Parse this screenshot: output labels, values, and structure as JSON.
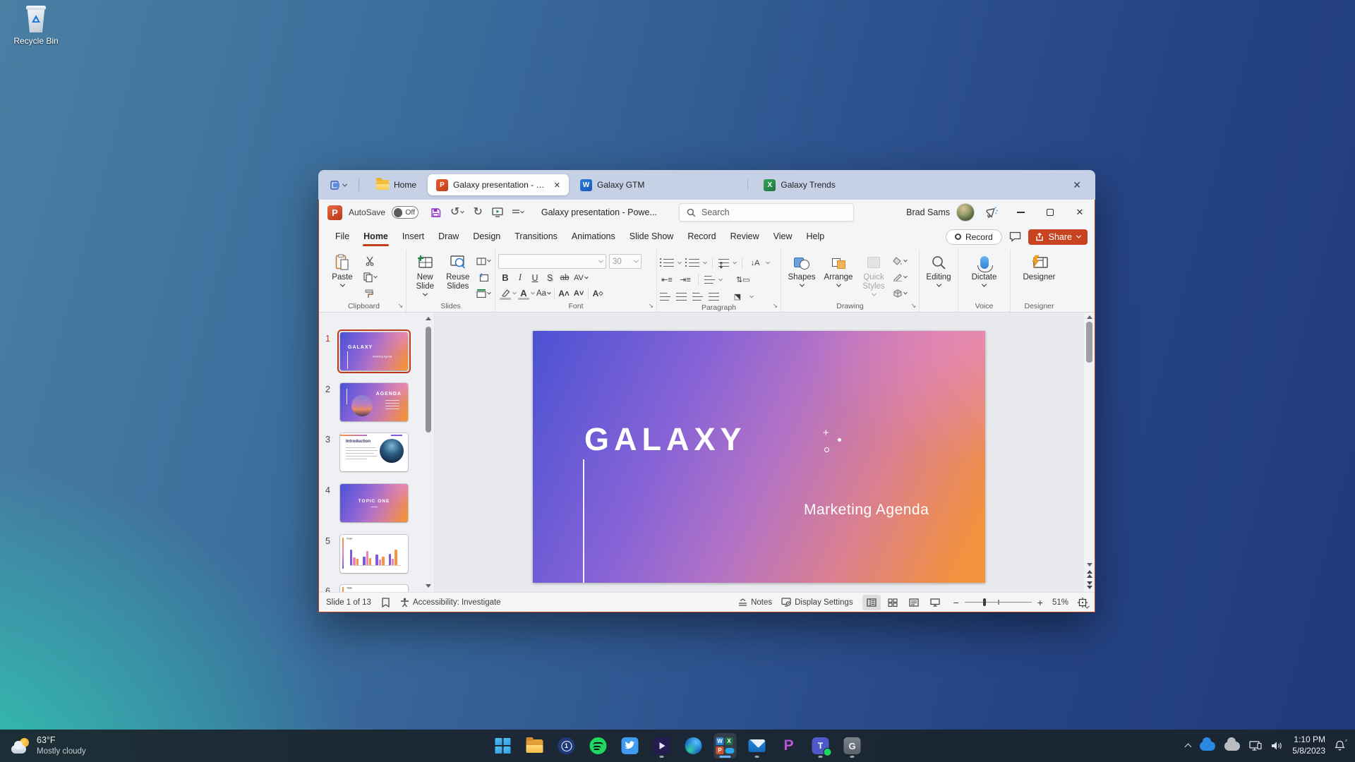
{
  "desktop": {
    "recycle_bin_label": "Recycle Bin"
  },
  "tabstrip": {
    "tabs": [
      {
        "label": "Home"
      },
      {
        "label": "Galaxy presentation - Pow...",
        "close": "✕"
      },
      {
        "label": "Galaxy GTM"
      },
      {
        "label": "Galaxy Trends"
      }
    ],
    "close": "✕"
  },
  "titlebar": {
    "autosave_label": "AutoSave",
    "autosave_state": "Off",
    "document_title": "Galaxy presentation  -  Powe...",
    "search_placeholder": "Search",
    "user_name": "Brad Sams",
    "minimize": "",
    "close": "✕"
  },
  "ribbon": {
    "tabs": [
      "File",
      "Home",
      "Insert",
      "Draw",
      "Design",
      "Transitions",
      "Animations",
      "Slide Show",
      "Record",
      "Review",
      "View",
      "Help"
    ],
    "record_button": "Record",
    "share_button": "Share",
    "clipboard": {
      "paste": "Paste",
      "label": "Clipboard"
    },
    "slides": {
      "new_slide": "New Slide",
      "reuse_slides": "Reuse Slides",
      "label": "Slides"
    },
    "font": {
      "size_value": "30",
      "label": "Font",
      "bold": "B",
      "italic": "I",
      "underline": "U",
      "shadow": "S"
    },
    "paragraph": {
      "label": "Paragraph"
    },
    "drawing": {
      "shapes": "Shapes",
      "arrange": "Arrange",
      "quick_styles": "Quick Styles",
      "label": "Drawing"
    },
    "editing": {
      "button": "Editing"
    },
    "voice": {
      "dictate": "Dictate",
      "label": "Voice"
    },
    "designer": {
      "button": "Designer",
      "label": "Designer"
    }
  },
  "slides_panel": {
    "items": [
      {
        "number": "1",
        "title": "GALAXY",
        "subtitle": "Marketing Agenda"
      },
      {
        "number": "2",
        "title": "AGENDA"
      },
      {
        "number": "3",
        "title": "Introduction"
      },
      {
        "number": "4",
        "title": "TOPIC ONE"
      },
      {
        "number": "5",
        "title": "Chart"
      },
      {
        "number": "6",
        "title": "Table"
      }
    ]
  },
  "slide": {
    "title": "GALAXY",
    "subtitle": "Marketing Agenda"
  },
  "statusbar": {
    "slide_position": "Slide 1 of 13",
    "accessibility": "Accessibility: Investigate",
    "notes": "Notes",
    "display_settings": "Display Settings",
    "zoom_level": "51%"
  },
  "taskbar": {
    "weather_temp": "63°F",
    "weather_condition": "Mostly cloudy",
    "clock_time": "1:10 PM",
    "clock_date": "5/8/2023",
    "pinned_icons": [
      "start",
      "file-explorer",
      "1password",
      "spotify",
      "twitter",
      "clipchamp",
      "edge",
      "microsoft-365",
      "mail",
      "loop",
      "teams",
      "galaxy-app"
    ]
  }
}
